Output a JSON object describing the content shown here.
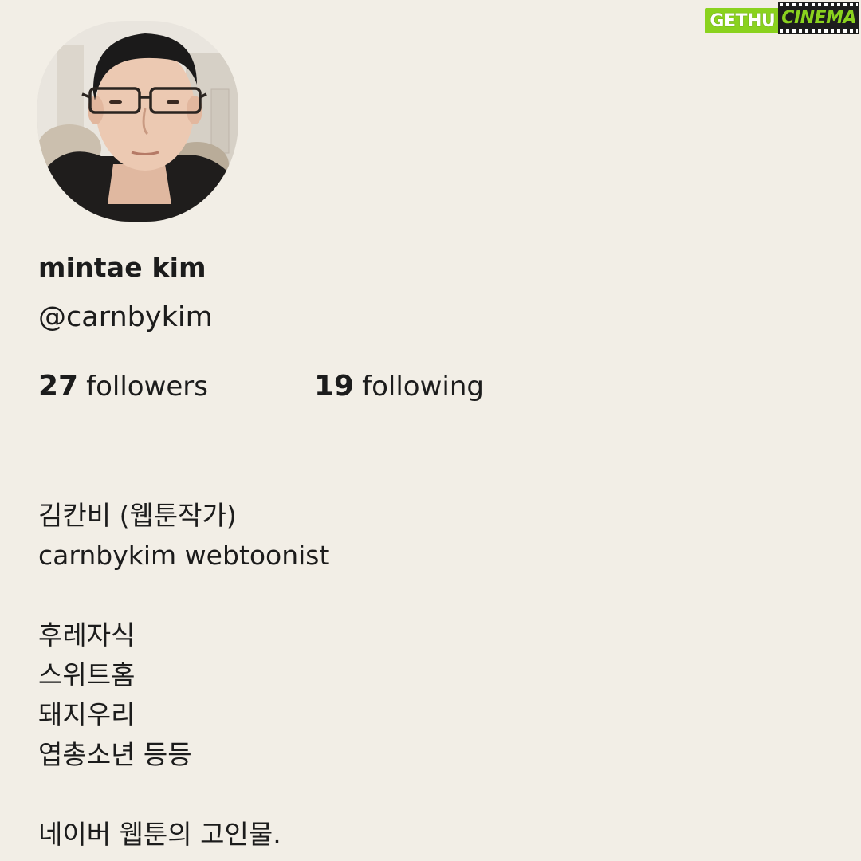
{
  "profile": {
    "display_name": "mintae kim",
    "handle": "@carnbykim",
    "avatar_icon": "user-portrait"
  },
  "stats": {
    "followers_count": "27",
    "followers_label": "followers",
    "following_count": "19",
    "following_label": "following"
  },
  "bio": {
    "line1": "김칸비 (웹툰작가)",
    "line2": "carnbykim webtoonist",
    "line3": "후레자식",
    "line4": "스위트홈",
    "line5": "돼지우리",
    "line6": "엽총소년 등등",
    "line7": "네이버 웹툰의 고인물."
  },
  "watermark": {
    "part1": "GETHU",
    "part2": "CINEMA"
  },
  "colors": {
    "background": "#f2eee6",
    "text": "#1c1c1c",
    "watermark_green": "#8ad21e"
  }
}
